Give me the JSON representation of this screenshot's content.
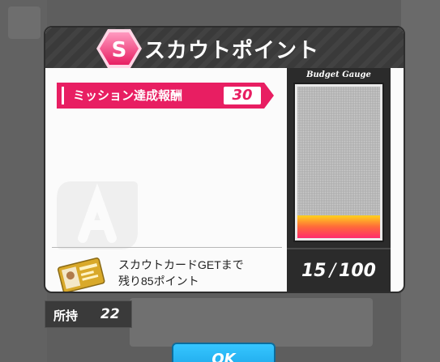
{
  "dialog": {
    "title": "スカウトポイント",
    "badge_letter": "S"
  },
  "mission": {
    "label": "ミッション達成報酬",
    "value": "30"
  },
  "gauge": {
    "title": "Budget Gauge",
    "current": "15",
    "max": "100",
    "fill_fraction": 0.15
  },
  "card_info": {
    "line1": "スカウトカードGETまで",
    "line2": "残り85ポイント"
  },
  "owned": {
    "label": "所持",
    "value": "22"
  },
  "ok_button": {
    "label": "OK"
  },
  "colors": {
    "accent": "#e81e62",
    "header": "#3a3a3a",
    "ok_button": "#1aa3e6"
  }
}
